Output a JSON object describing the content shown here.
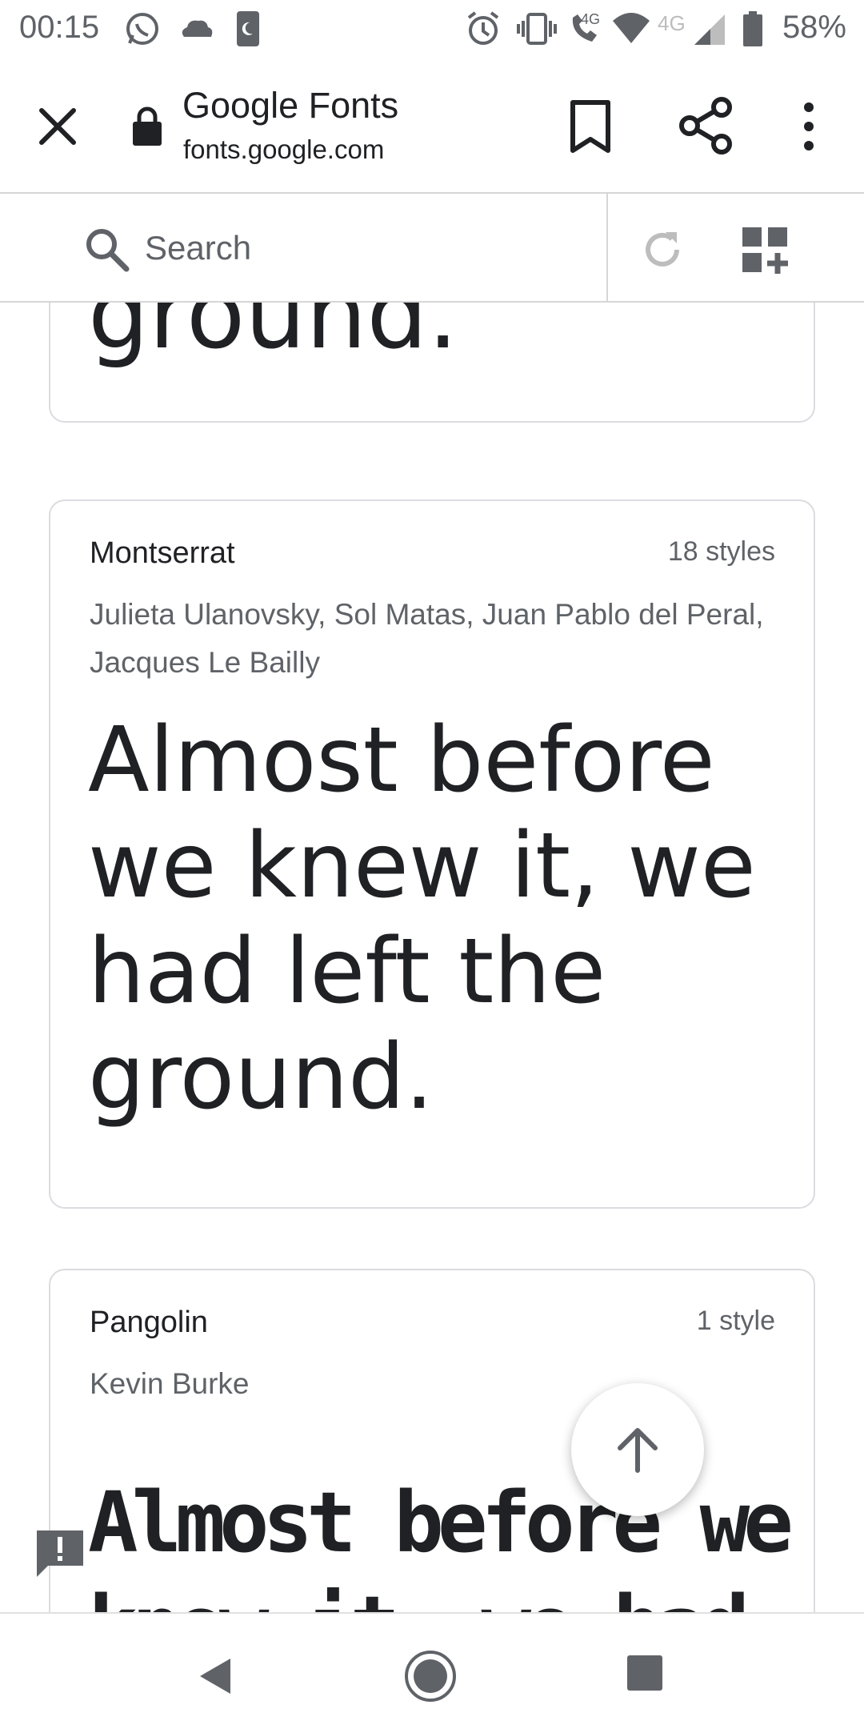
{
  "status_bar": {
    "time": "00:15",
    "network_label_1": "4G",
    "network_label_2": "4G",
    "battery": "58%"
  },
  "browser": {
    "page_title": "Google Fonts",
    "page_url": "fonts.google.com"
  },
  "site": {
    "search_placeholder": "Search"
  },
  "cards": [
    {
      "preview": "ground."
    },
    {
      "font_name": "Montserrat",
      "styles": "18 styles",
      "designers": "Julieta Ulanovsky, Sol Matas, Juan Pablo del Peral, Jacques Le Bailly",
      "preview": "Almost before we knew it, we had left the ground."
    },
    {
      "font_name": "Pangolin",
      "styles": "1 style",
      "designers": "Kevin Burke",
      "preview": "Almost before we knew it, we had left the ground."
    }
  ],
  "colors": {
    "text_primary": "#202124",
    "text_secondary": "#5f6368",
    "border": "#dadce0",
    "icon_grey": "#5f6368"
  }
}
